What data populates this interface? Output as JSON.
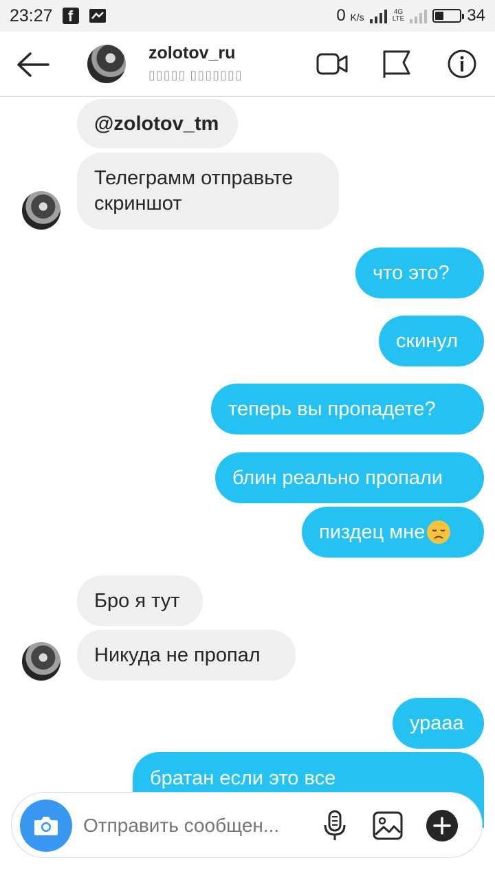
{
  "status_bar": {
    "time": "23:27",
    "net_speed": "0",
    "net_unit": "K/s",
    "network_type": "4G",
    "network_sub": "LTE",
    "battery_pct": "34",
    "battery_level": 0.34,
    "icons": [
      "facebook-icon",
      "notification-icon",
      "signal-icon",
      "battery-icon"
    ]
  },
  "header": {
    "username": "zolotov_ru",
    "subtitle": "▯▯▯▯▯ ▯▯▯▯▯▯▯",
    "icons": [
      "back-arrow-icon",
      "video-call-icon",
      "flag-icon",
      "info-icon"
    ]
  },
  "messages": [
    {
      "side": "in",
      "text": "@zolotov_tm"
    },
    {
      "side": "in",
      "lines": [
        "Телеграмм отправьте",
        "скриншот"
      ]
    },
    {
      "side": "out",
      "text": "что это?"
    },
    {
      "side": "out",
      "text": "скинул"
    },
    {
      "side": "out",
      "text": "теперь вы пропадете?"
    },
    {
      "side": "out",
      "text": "блин реально пропали"
    },
    {
      "side": "out",
      "text": "пиздец мне",
      "emoji": "disappointed-face"
    },
    {
      "side": "in",
      "text": "Бро я тут"
    },
    {
      "side": "in",
      "text": "Никуда не пропал"
    },
    {
      "side": "out",
      "text": "урааа"
    },
    {
      "side": "out",
      "text": "братан если это все"
    }
  ],
  "composer": {
    "placeholder": "Отправить сообщен...",
    "icons": [
      "camera-icon",
      "microphone-icon",
      "gallery-icon",
      "plus-icon"
    ]
  },
  "colors": {
    "outgoing_bubble": "#24c1f3",
    "incoming_bubble": "#efefef",
    "camera_button": "#3897f0"
  }
}
